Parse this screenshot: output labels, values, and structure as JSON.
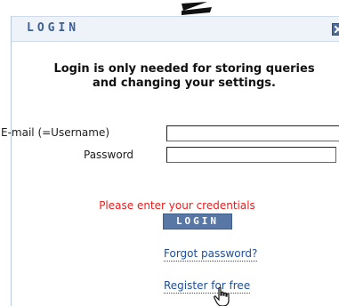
{
  "login": {
    "title": "LOGIN",
    "intro_line1": "Login is only needed for storing queries",
    "intro_line2": "and changing your settings.",
    "email_label": "E-mail (=Username)",
    "email_value": "",
    "password_label": "Password",
    "password_value": "",
    "error_message": "Please enter your credentials",
    "login_button": "LOGIN",
    "forgot_link": "Forgot password?",
    "register_link": "Register for free"
  },
  "colors": {
    "accent": "#5877a5",
    "header_text": "#3d5f96",
    "error": "#ee1c1c",
    "link": "#1d4f9c"
  }
}
